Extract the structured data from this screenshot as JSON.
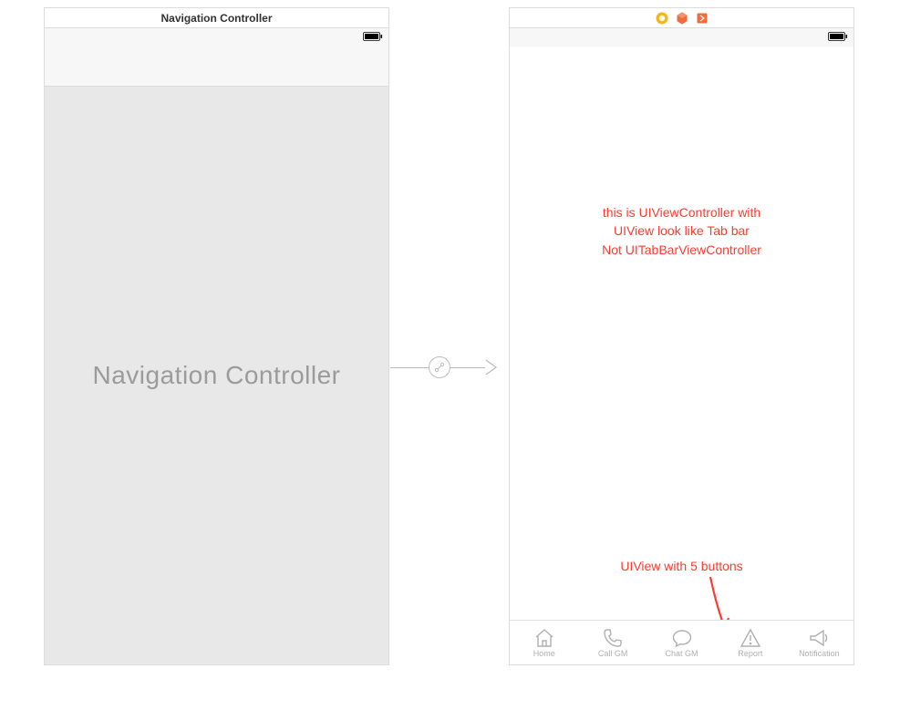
{
  "left_scene": {
    "title": "Navigation Controller",
    "placeholder": "Navigation Controller"
  },
  "right_scene": {
    "annotation1_line1": "this is UIViewController with",
    "annotation1_line2": "UIView look like Tab bar",
    "annotation1_line3": "Not UITabBarViewController",
    "annotation2": "UIView with 5 buttons",
    "tabs": {
      "home": "Home",
      "callgm": "Call GM",
      "chatgm": "Chat GM",
      "report": "Report",
      "notification": "Notification"
    }
  }
}
